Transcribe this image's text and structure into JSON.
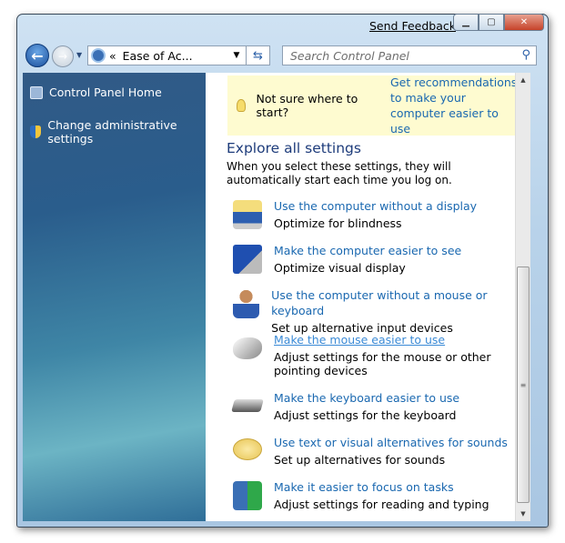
{
  "titlebar": {
    "send_feedback": "Send Feedback",
    "minimize": "▭",
    "maximize": "□",
    "close": "✕"
  },
  "nav": {
    "address": "Ease of Ac...",
    "address_prefix": "«",
    "search_placeholder": "Search Control Panel"
  },
  "sidebar": {
    "items": [
      {
        "label": "Control Panel Home",
        "icon": "control-panel-icon"
      },
      {
        "label": "Change administrative settings",
        "icon": "shield-icon"
      }
    ]
  },
  "tip": {
    "question": "Not sure where to start?",
    "link": "Get recommendations to make your computer easier to use"
  },
  "section": {
    "title": "Explore all settings",
    "description": "When you select these settings, they will automatically start each time you log on."
  },
  "settings": [
    {
      "link": "Use the computer without a display",
      "sub": "Optimize for blindness",
      "icon": "narrator-monitor-icon"
    },
    {
      "link": "Make the computer easier to see",
      "sub": "Optimize visual display",
      "icon": "magnifier-monitor-icon"
    },
    {
      "link": "Use the computer without a mouse or keyboard",
      "sub": "Set up alternative input devices",
      "icon": "headset-person-icon"
    },
    {
      "link": "Make the mouse easier to use",
      "sub": "Adjust settings for the mouse or other pointing devices",
      "icon": "mouse-icon",
      "hovered": true
    },
    {
      "link": "Make the keyboard easier to use",
      "sub": "Adjust settings for the keyboard",
      "icon": "keyboard-icon"
    },
    {
      "link": "Use text or visual alternatives for sounds",
      "sub": "Set up alternatives for sounds",
      "icon": "speech-bubble-icon"
    },
    {
      "link": "Make it easier to focus on tasks",
      "sub": "Adjust settings for reading and typing",
      "icon": "person-book-icon"
    }
  ],
  "colors": {
    "link": "#1a68b0",
    "heading": "#1e3c7b",
    "tip_bg": "#fefbd0"
  }
}
